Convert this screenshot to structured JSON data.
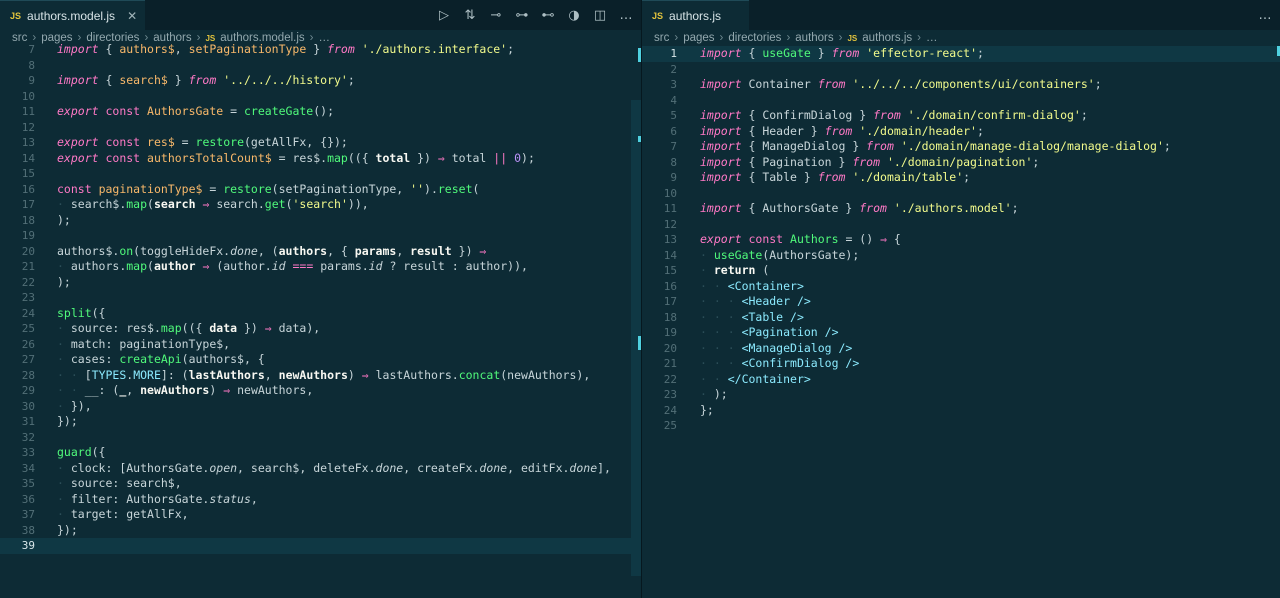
{
  "left": {
    "tab": {
      "badge": "JS",
      "label": "authors.model.js",
      "close": "✕"
    },
    "more": "…",
    "breadcrumb": [
      "src",
      "pages",
      "directories",
      "authors",
      "authors.model.js",
      "…"
    ],
    "lines": [
      {
        "n": "7",
        "html": "<span class='kw'>import</span> { <span class='var'>authors$</span>, <span class='var'>setPaginationType</span> } <span class='kw'>from</span> <span class='str'>'./authors.interface'</span>;"
      },
      {
        "n": "8",
        "html": ""
      },
      {
        "n": "9",
        "html": "<span class='kw'>import</span> { <span class='var'>search$</span> } <span class='kw'>from</span> <span class='str'>'../../../history'</span>;"
      },
      {
        "n": "10",
        "html": ""
      },
      {
        "n": "11",
        "html": "<span class='kw'>export</span> <span class='kw2'>const</span> <span class='var'>AuthorsGate</span> = <span class='fn'>createGate</span>();"
      },
      {
        "n": "12",
        "html": ""
      },
      {
        "n": "13",
        "html": "<span class='kw'>export</span> <span class='kw2'>const</span> <span class='var'>res$</span> = <span class='fn'>restore</span>(getAllFx, {});"
      },
      {
        "n": "14",
        "html": "<span class='kw'>export</span> <span class='kw2'>const</span> <span class='var'>authorsTotalCount$</span> = res$.<span class='fn'>map</span>(({ <span class='bold'>total</span> }) <span class='op'>⇒</span> total <span class='op'>||</span> <span class='num'>0</span>);"
      },
      {
        "n": "15",
        "html": ""
      },
      {
        "n": "16",
        "html": "<span class='kw2'>const</span> <span class='var'>paginationType$</span> = <span class='fn'>restore</span>(setPaginationType, <span class='str'>''</span>).<span class='fn'>reset</span>("
      },
      {
        "n": "17",
        "html": "<span class='guide'>·</span> search$.<span class='fn'>map</span>(<span class='bold'>search</span> <span class='op'>⇒</span> search.<span class='fn'>get</span>(<span class='str'>'search'</span>)),"
      },
      {
        "n": "18",
        "html": ");"
      },
      {
        "n": "19",
        "html": ""
      },
      {
        "n": "20",
        "html": "authors$.<span class='fn'>on</span>(toggleHideFx.<span class='ital'>done</span>, (<span class='bold'>authors</span>, { <span class='bold'>params</span>, <span class='bold'>result</span> }) <span class='op'>⇒</span>"
      },
      {
        "n": "21",
        "html": "<span class='guide'>·</span> authors.<span class='fn'>map</span>(<span class='bold'>author</span> <span class='op'>⇒</span> (author.<span class='ital'>id</span> <span class='op'>===</span> params.<span class='ital'>id</span> ? result : author)),"
      },
      {
        "n": "22",
        "html": ");"
      },
      {
        "n": "23",
        "html": ""
      },
      {
        "n": "24",
        "html": "<span class='fn'>split</span>({"
      },
      {
        "n": "25",
        "html": "<span class='guide'>·</span> source: res$.<span class='fn'>map</span>(({ <span class='bold'>data</span> }) <span class='op'>⇒</span> data),"
      },
      {
        "n": "26",
        "html": "<span class='guide'>·</span> match: paginationType$,"
      },
      {
        "n": "27",
        "html": "<span class='guide'>·</span> cases: <span class='fn'>createApi</span>(authors$, {"
      },
      {
        "n": "28",
        "html": "<span class='guide'>· ·</span> [<span class='cls'>TYPES</span>.<span class='cls'>MORE</span>]: (<span class='bold'>lastAuthors</span>, <span class='bold'>newAuthors</span>) <span class='op'>⇒</span> lastAuthors.<span class='fn'>concat</span>(newAuthors),"
      },
      {
        "n": "29",
        "html": "<span class='guide'>· ·</span> __: (<span class='bold'>_</span>, <span class='bold'>newAuthors</span>) <span class='op'>⇒</span> newAuthors,"
      },
      {
        "n": "30",
        "html": "<span class='guide'>·</span> }),"
      },
      {
        "n": "31",
        "html": "});"
      },
      {
        "n": "32",
        "html": ""
      },
      {
        "n": "33",
        "html": "<span class='fn'>guard</span>({"
      },
      {
        "n": "34",
        "html": "<span class='guide'>·</span> clock: [AuthorsGate.<span class='ital'>open</span>, search$, deleteFx.<span class='ital'>done</span>, createFx.<span class='ital'>done</span>, editFx.<span class='ital'>done</span>],"
      },
      {
        "n": "35",
        "html": "<span class='guide'>·</span> source: search$,"
      },
      {
        "n": "36",
        "html": "<span class='guide'>·</span> filter: AuthorsGate.<span class='ital'>status</span>,"
      },
      {
        "n": "37",
        "html": "<span class='guide'>·</span> target: getAllFx,"
      },
      {
        "n": "38",
        "html": "});"
      },
      {
        "n": "39",
        "html": ""
      }
    ]
  },
  "right": {
    "tab": {
      "badge": "JS",
      "label": "authors.js"
    },
    "more": "…",
    "breadcrumb": [
      "src",
      "pages",
      "directories",
      "authors",
      "authors.js",
      "…"
    ],
    "lines": [
      {
        "n": "1",
        "html": "<span class='kw'>import</span> { <span class='fn'>useGate</span> } <span class='kw'>from</span> <span class='str'>'effector-react'</span>;"
      },
      {
        "n": "2",
        "html": ""
      },
      {
        "n": "3",
        "html": "<span class='kw'>import</span> Container <span class='kw'>from</span> <span class='str'>'../../../components/ui/containers'</span>;"
      },
      {
        "n": "4",
        "html": ""
      },
      {
        "n": "5",
        "html": "<span class='kw'>import</span> { ConfirmDialog } <span class='kw'>from</span> <span class='str'>'./domain/confirm-dialog'</span>;"
      },
      {
        "n": "6",
        "html": "<span class='kw'>import</span> { Header } <span class='kw'>from</span> <span class='str'>'./domain/header'</span>;"
      },
      {
        "n": "7",
        "html": "<span class='kw'>import</span> { ManageDialog } <span class='kw'>from</span> <span class='str'>'./domain/manage-dialog/manage-dialog'</span>;"
      },
      {
        "n": "8",
        "html": "<span class='kw'>import</span> { Pagination } <span class='kw'>from</span> <span class='str'>'./domain/pagination'</span>;"
      },
      {
        "n": "9",
        "html": "<span class='kw'>import</span> { Table } <span class='kw'>from</span> <span class='str'>'./domain/table'</span>;"
      },
      {
        "n": "10",
        "html": ""
      },
      {
        "n": "11",
        "html": "<span class='kw'>import</span> { AuthorsGate } <span class='kw'>from</span> <span class='str'>'./authors.model'</span>;"
      },
      {
        "n": "12",
        "html": ""
      },
      {
        "n": "13",
        "html": "<span class='kw'>export</span> <span class='kw2'>const</span> <span class='fn'>Authors</span> = () <span class='op'>⇒</span> {"
      },
      {
        "n": "14",
        "html": "<span class='guide'>·</span> <span class='fn'>useGate</span>(AuthorsGate);"
      },
      {
        "n": "15",
        "html": "<span class='guide'>·</span> <span class='bold'>return</span> ("
      },
      {
        "n": "16",
        "html": "<span class='guide'>· ·</span> <span class='tag'>&lt;Container&gt;</span>"
      },
      {
        "n": "17",
        "html": "<span class='guide'>· · ·</span> <span class='tag'>&lt;Header /&gt;</span>"
      },
      {
        "n": "18",
        "html": "<span class='guide'>· · ·</span> <span class='tag'>&lt;Table /&gt;</span>"
      },
      {
        "n": "19",
        "html": "<span class='guide'>· · ·</span> <span class='tag'>&lt;Pagination /&gt;</span>"
      },
      {
        "n": "20",
        "html": "<span class='guide'>· · ·</span> <span class='tag'>&lt;ManageDialog /&gt;</span>"
      },
      {
        "n": "21",
        "html": "<span class='guide'>· · ·</span> <span class='tag'>&lt;ConfirmDialog /&gt;</span>"
      },
      {
        "n": "22",
        "html": "<span class='guide'>· ·</span> <span class='tag'>&lt;/Container&gt;</span>"
      },
      {
        "n": "23",
        "html": "<span class='guide'>·</span> );"
      },
      {
        "n": "24",
        "html": "};"
      },
      {
        "n": "25",
        "html": ""
      }
    ]
  },
  "colors": {
    "background": "#0d2b35",
    "accent": "#4fd1e0",
    "keyword": "#ff79c6",
    "string": "#f1fa8c",
    "function": "#50fa7b"
  }
}
